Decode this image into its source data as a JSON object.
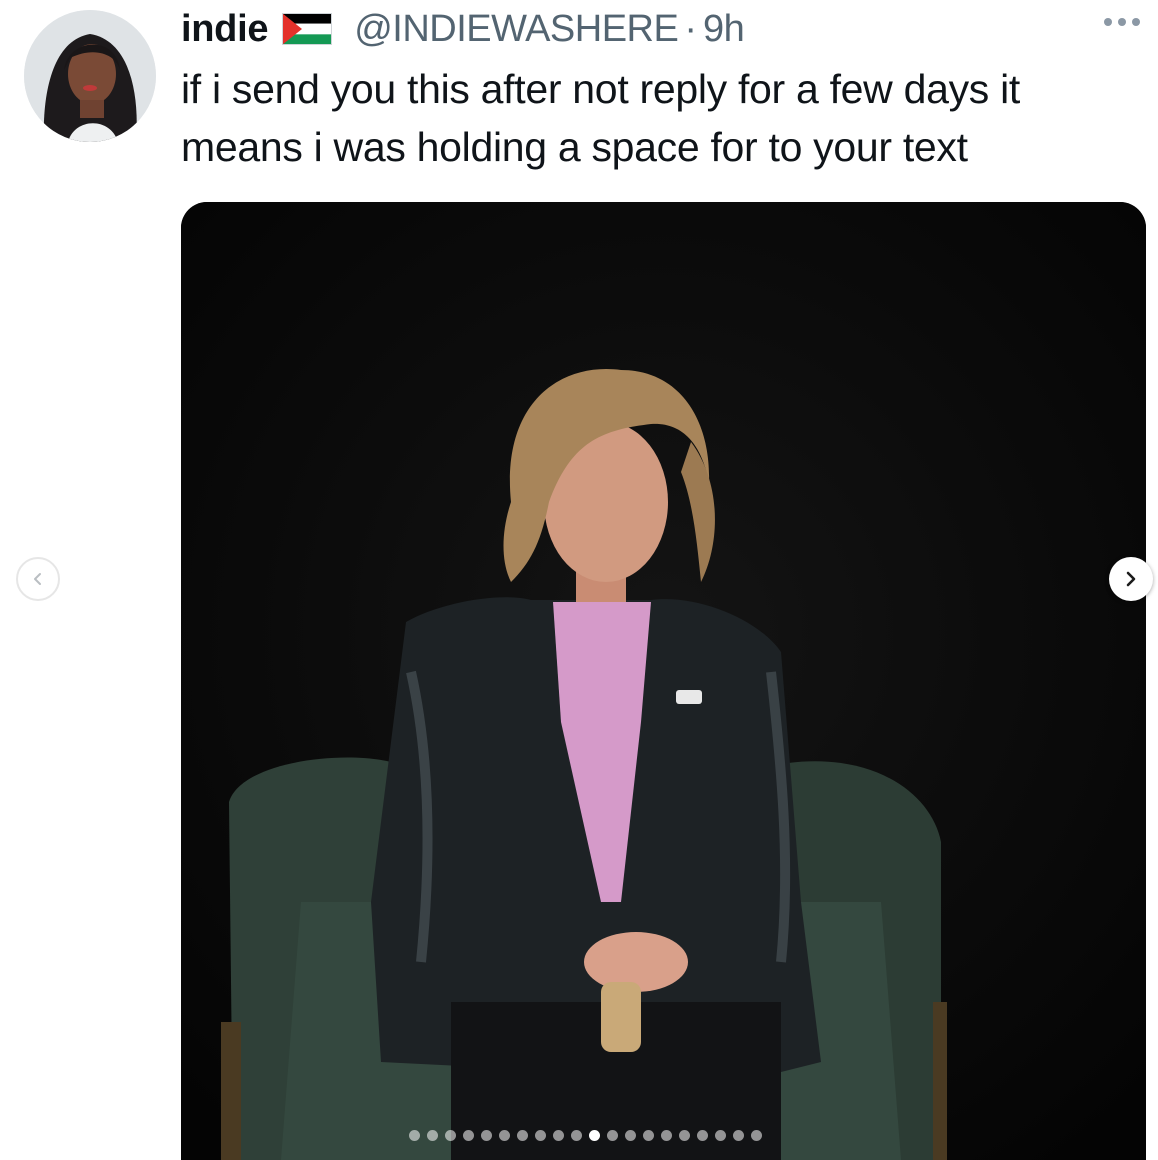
{
  "tweet": {
    "display_name": "indie",
    "flag_icon": "palestine-flag-icon",
    "handle": "@INDIEWASHERE",
    "separator": "·",
    "time": "9h",
    "text": "if i send you this after not reply for a few days it means i was holding a space for to your text"
  },
  "carousel": {
    "total_slides": 20,
    "active_index": 10
  },
  "colors": {
    "secondary_text": "#536471",
    "flag_black": "#000000",
    "flag_white": "#ffffff",
    "flag_green": "#149954",
    "flag_red": "#e4312b"
  }
}
